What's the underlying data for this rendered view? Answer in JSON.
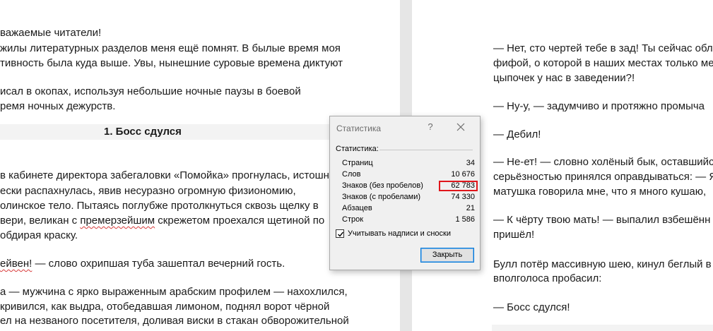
{
  "left_page": {
    "lines": [
      "важаемые читатели!",
      "жилы литературных разделов меня ещё помнят. В былые время моя",
      "тивность была куда выше. Увы, нынешние суровые времена диктуют",
      "исал в окопах, используя небольшие ночные паузы в боевой",
      "ремя ночных дежурств.",
      "1. Босс сдулся",
      "в кабинете директора забегаловки «Помойка» прогнулась, истошн",
      "ески распахнулась, явив несуразно огромную физиономию,",
      "олинское тело. Пытаясь поглубже протолкнуться сквозь щелку в",
      "вери, великан с ",
      "премерзейшим",
      " скрежетом проехался щетиной по",
      "обдирая краску.",
      "ейвен!",
      " — слово охрипшая туба зашептал вечерний гость.",
      "а — мужчина с ярко выраженным арабским профилем — нахохлился,",
      "кривился, как выдра, отобедавшая лимоном, поднял ворот чёрной",
      "ел на незваного посетителя, доливая виски в стакан обворожительной"
    ]
  },
  "right_page": {
    "lines": [
      "— Нет, сто чертей тебе в зад! Ты сейчас обл",
      "фифой, о которой в наших местах только ме",
      "цыпочек у нас в заведении?!",
      "— Ну-у, — задумчиво и протяжно промыча",
      "— Дебил!",
      "— Не-ет! — словно холёный бык, оставшийс",
      "серьёзностью принялся оправдываться: — Я",
      "матушка говорила мне, что я много кушаю,",
      "— К чёрту твою мать! — выпалил взбешённ",
      "пришёл!",
      "Булл потёр массивную шею, кинул беглый в",
      "вполголоса пробасил:",
      "— Босс сдулся!"
    ]
  },
  "dialog": {
    "title": "Статистика",
    "help_label": "?",
    "section_label": "Статистика:",
    "rows": [
      {
        "label": "Страниц",
        "value": "34"
      },
      {
        "label": "Слов",
        "value": "10 676"
      },
      {
        "label": "Знаков (без пробелов)",
        "value": "62 783"
      },
      {
        "label": "Знаков (с пробелами)",
        "value": "74 330"
      },
      {
        "label": "Абзацев",
        "value": "21"
      },
      {
        "label": "Строк",
        "value": "1 586"
      }
    ],
    "checkbox_label": "Учитывать надписи и сноски",
    "checkbox_checked": true,
    "ok_label": "Закрыть",
    "highlight_color": "#e0161b"
  }
}
